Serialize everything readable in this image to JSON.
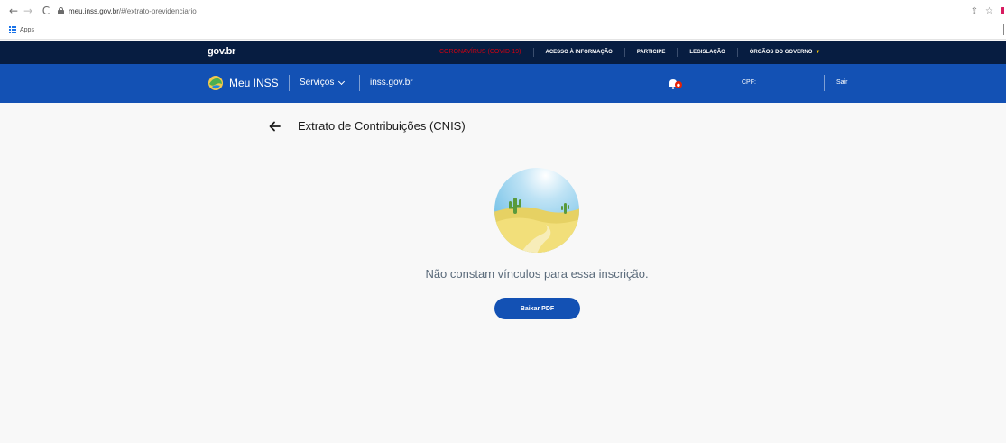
{
  "browser": {
    "url_host": "meu.inss.gov.br",
    "url_path": "/#/extrato-previdenciario",
    "bookmarks": {
      "apps_label": "Apps"
    }
  },
  "gov_bar": {
    "logo": "gov.br",
    "links": [
      {
        "label": "CORONAVÍRUS (COVID-19)",
        "emphasis": true
      },
      {
        "label": "ACESSO À INFORMAÇÃO",
        "emphasis": false
      },
      {
        "label": "PARTICIPE",
        "emphasis": false
      },
      {
        "label": "LEGISLAÇÃO",
        "emphasis": false
      },
      {
        "label": "ÓRGÃOS DO GOVERNO",
        "emphasis": false
      }
    ]
  },
  "inss_header": {
    "brand": "Meu INSS",
    "services": "Serviços",
    "site_link": "inss.gov.br",
    "cpf_label": "CPF:",
    "logout": "Sair"
  },
  "page": {
    "title": "Extrato de Contribuições (CNIS)",
    "empty_message": "Não constam vínculos para essa inscrição.",
    "pdf_button": "Baixar PDF"
  },
  "colors": {
    "gov_bar_bg": "#071d41",
    "inss_bar_bg": "#1351b4",
    "covid_red": "#d4000f",
    "button_blue": "#1351b4"
  }
}
